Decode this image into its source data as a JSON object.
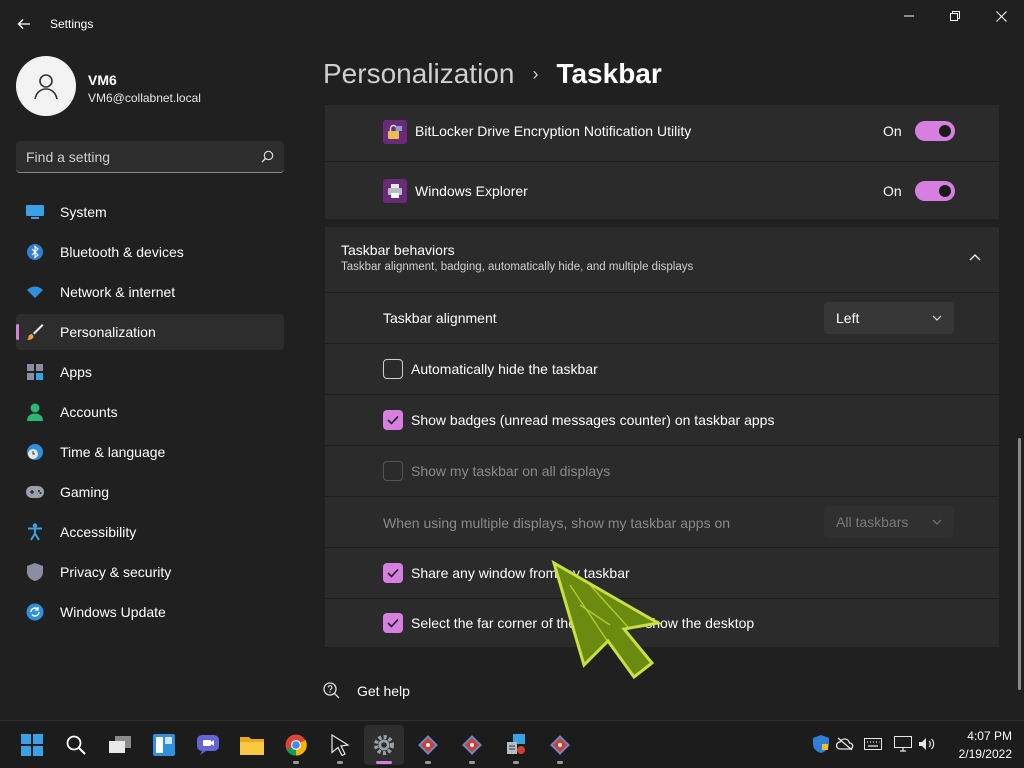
{
  "window": {
    "app_title": "Settings",
    "back_icon": "back-arrow-icon",
    "controls": [
      "minimize-icon",
      "restore-icon",
      "close-icon"
    ]
  },
  "profile": {
    "name": "VM6",
    "email": "VM6@collabnet.local"
  },
  "search": {
    "placeholder": "Find a setting"
  },
  "nav": {
    "items": [
      {
        "label": "System",
        "icon": "system-icon"
      },
      {
        "label": "Bluetooth & devices",
        "icon": "bluetooth-icon"
      },
      {
        "label": "Network & internet",
        "icon": "wifi-icon"
      },
      {
        "label": "Personalization",
        "icon": "paintbrush-icon",
        "active": true
      },
      {
        "label": "Apps",
        "icon": "apps-icon"
      },
      {
        "label": "Accounts",
        "icon": "person-icon"
      },
      {
        "label": "Time & language",
        "icon": "clock-globe-icon"
      },
      {
        "label": "Gaming",
        "icon": "gamepad-icon"
      },
      {
        "label": "Accessibility",
        "icon": "accessibility-icon"
      },
      {
        "label": "Privacy & security",
        "icon": "shield-icon"
      },
      {
        "label": "Windows Update",
        "icon": "update-icon"
      }
    ]
  },
  "breadcrumb": {
    "parent": "Personalization",
    "separator": "›",
    "current": "Taskbar"
  },
  "overflow_items": [
    {
      "label": "BitLocker Drive Encryption Notification Utility",
      "state": "On",
      "icon": "bitlocker-icon"
    },
    {
      "label": "Windows Explorer",
      "state": "On",
      "icon": "printer-icon"
    }
  ],
  "behaviors": {
    "title": "Taskbar behaviors",
    "subtitle": "Taskbar alignment, badging, automatically hide, and multiple displays",
    "alignment_label": "Taskbar alignment",
    "alignment_value": "Left",
    "auto_hide_label": "Automatically hide the taskbar",
    "auto_hide_checked": false,
    "badges_label": "Show badges (unread messages counter) on taskbar apps",
    "badges_checked": true,
    "all_displays_label": "Show my taskbar on all displays",
    "all_displays_checked": false,
    "multi_display_label": "When using multiple displays, show my taskbar apps on",
    "multi_display_value": "All taskbars",
    "share_label": "Share any window from my taskbar",
    "share_checked": true,
    "far_corner_label": "Select the far corner of the taskbar to show the desktop",
    "far_corner_checked": true
  },
  "footer": {
    "get_help": "Get help"
  },
  "taskbar": {
    "apps": [
      {
        "name": "start-icon"
      },
      {
        "name": "search-icon"
      },
      {
        "name": "task-view-icon"
      },
      {
        "name": "widgets-icon"
      },
      {
        "name": "teams-chat-icon"
      },
      {
        "name": "file-explorer-icon"
      },
      {
        "name": "chrome-icon",
        "running": true
      },
      {
        "name": "cursor-app-icon",
        "running": true
      },
      {
        "name": "settings-icon",
        "running": true,
        "active": true
      },
      {
        "name": "git-icon",
        "running": true
      },
      {
        "name": "git-icon-2",
        "running": true
      },
      {
        "name": "network-tool-icon",
        "running": true
      },
      {
        "name": "git-icon-3",
        "running": true
      }
    ],
    "tray": [
      "defender-icon",
      "cloud-icon",
      "keyboard-icon",
      "network-icon",
      "volume-icon"
    ],
    "time": "4:07 PM",
    "date": "2/19/2022"
  },
  "colors": {
    "accent": "#d67fe0",
    "background": "#202020",
    "card": "#2b2b2b"
  }
}
